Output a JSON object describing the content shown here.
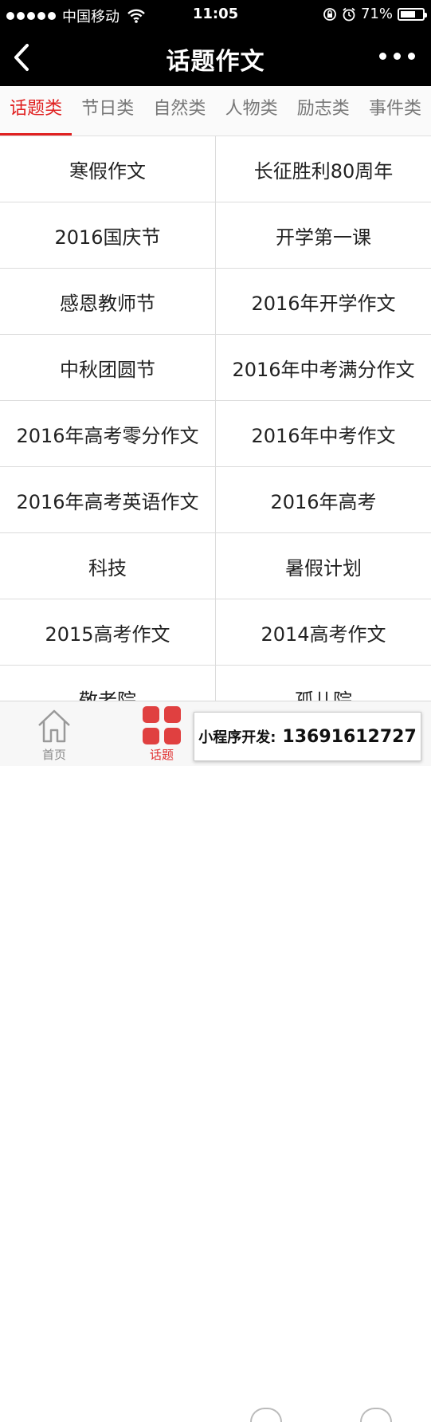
{
  "status_bar": {
    "carrier": "中国移动",
    "time": "11:05",
    "battery_text": "71%",
    "battery_level": 0.71
  },
  "nav": {
    "title": "话题作文"
  },
  "tabs": [
    {
      "label": "话题类",
      "active": true
    },
    {
      "label": "节日类",
      "active": false
    },
    {
      "label": "自然类",
      "active": false
    },
    {
      "label": "人物类",
      "active": false
    },
    {
      "label": "励志类",
      "active": false
    },
    {
      "label": "事件类",
      "active": false
    }
  ],
  "topics": [
    [
      "寒假作文",
      "长征胜利80周年"
    ],
    [
      "2016国庆节",
      "开学第一课"
    ],
    [
      "感恩教师节",
      "2016年开学作文"
    ],
    [
      "中秋团圆节",
      "2016年中考满分作文"
    ],
    [
      "2016年高考零分作文",
      "2016年中考作文"
    ],
    [
      "2016年高考英语作文",
      "2016年高考"
    ],
    [
      "科技",
      "暑假计划"
    ],
    [
      "2015高考作文",
      "2014高考作文"
    ],
    [
      "敬老院",
      "孤儿院"
    ]
  ],
  "tabbar": {
    "home_label": "首页",
    "topics_label": "话题"
  },
  "promo": {
    "label": "小程序开发:",
    "phone": "13691612727"
  },
  "colors": {
    "accent": "#e02020",
    "navbar": "#000000"
  }
}
